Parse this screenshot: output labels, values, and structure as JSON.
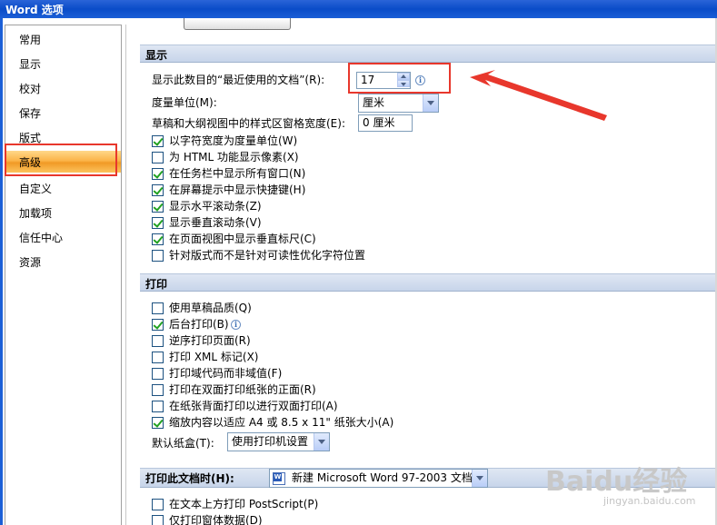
{
  "window": {
    "title": "Word 选项"
  },
  "sidebar": {
    "items": [
      {
        "label": "常用"
      },
      {
        "label": "显示"
      },
      {
        "label": "校对"
      },
      {
        "label": "保存"
      },
      {
        "label": "版式"
      },
      {
        "label": "高级",
        "selected": true
      },
      {
        "label": "自定义"
      },
      {
        "label": "加载项"
      },
      {
        "label": "信任中心"
      },
      {
        "label": "资源"
      }
    ]
  },
  "display_section": {
    "header": "显示",
    "recent_docs": {
      "label": "显示此数目的“最近使用的文档”(R):",
      "value": "17"
    },
    "units": {
      "label": "度量单位(M):",
      "value": "厘米"
    },
    "style_area": {
      "label": "草稿和大纲视图中的样式区窗格宽度(E):",
      "value": "0 厘米"
    },
    "options": [
      {
        "label": "以字符宽度为度量单位(W)",
        "checked": true
      },
      {
        "label": "为 HTML 功能显示像素(X)",
        "checked": false
      },
      {
        "label": "在任务栏中显示所有窗口(N)",
        "checked": true
      },
      {
        "label": "在屏幕提示中显示快捷键(H)",
        "checked": true
      },
      {
        "label": "显示水平滚动条(Z)",
        "checked": true
      },
      {
        "label": "显示垂直滚动条(V)",
        "checked": true
      },
      {
        "label": "在页面视图中显示垂直标尺(C)",
        "checked": true
      },
      {
        "label": "针对版式而不是针对可读性优化字符位置",
        "checked": false
      }
    ]
  },
  "print_section": {
    "header": "打印",
    "options": [
      {
        "label": "使用草稿品质(Q)",
        "checked": false
      },
      {
        "label": "后台打印(B)",
        "checked": true
      },
      {
        "label": "逆序打印页面(R)",
        "checked": false
      },
      {
        "label": "打印 XML 标记(X)",
        "checked": false
      },
      {
        "label": "打印域代码而非域值(F)",
        "checked": false
      },
      {
        "label": "打印在双面打印纸张的正面(R)",
        "checked": false
      },
      {
        "label": "在纸张背面打印以进行双面打印(A)",
        "checked": false
      },
      {
        "label": "缩放内容以适应 A4 或 8.5 x 11\" 纸张大小(A)",
        "checked": true
      }
    ],
    "tray": {
      "label": "默认纸盒(T):",
      "value": "使用打印机设置"
    }
  },
  "print_doc_section": {
    "header": "打印此文档时(H):",
    "document": "新建 Microsoft Word 97-2003 文档",
    "options": [
      {
        "label": "在文本上方打印 PostScript(P)",
        "checked": false
      },
      {
        "label": "仅打印窗体数据(D)",
        "checked": false
      }
    ]
  },
  "watermark": {
    "text": "Baidu经验",
    "sub": "jingyan.baidu.com"
  },
  "colors": {
    "selected_nav": "#f19a25",
    "highlight": "#e8372c",
    "titlebar": "#0a4cc8"
  }
}
